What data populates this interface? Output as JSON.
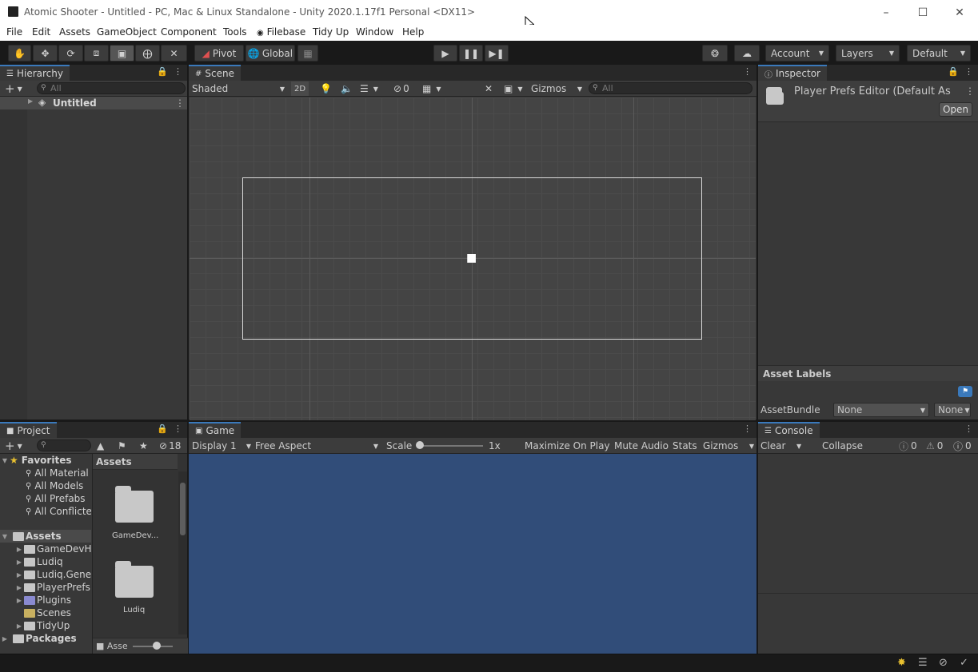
{
  "window": {
    "title": "Atomic Shooter - Untitled - PC, Mac & Linux Standalone - Unity 2020.1.17f1 Personal <DX11>"
  },
  "menu": [
    "File",
    "Edit",
    "Assets",
    "GameObject",
    "Component",
    "Tools",
    "Filebase",
    "Tidy Up",
    "Window",
    "Help"
  ],
  "toolbar": {
    "pivot": "Pivot",
    "global": "Global",
    "account": "Account",
    "layers": "Layers",
    "layout": "Default"
  },
  "hierarchy": {
    "tab": "Hierarchy",
    "search_placeholder": "All",
    "scene_name": "Untitled"
  },
  "scene": {
    "tab": "Scene",
    "shading": "Shaded",
    "mode_2d": "2D",
    "hidden_count": "0",
    "gizmos": "Gizmos",
    "search_placeholder": "All"
  },
  "inspector": {
    "tab": "Inspector",
    "title": "Player Prefs Editor (Default As",
    "open": "Open",
    "asset_labels": "Asset Labels",
    "assetbundle_label": "AssetBundle",
    "assetbundle_value": "None",
    "variant_value": "None"
  },
  "project": {
    "tab": "Project",
    "hidden_count": "18",
    "favorites_label": "Favorites",
    "favorites": [
      "All Material",
      "All Models",
      "All Prefabs",
      "All Conflicte"
    ],
    "assets_label": "Assets",
    "assets": [
      "GameDevH",
      "Ludiq",
      "Ludiq.Gene",
      "PlayerPrefs",
      "Plugins",
      "Scenes",
      "TidyUp"
    ],
    "packages_label": "Packages",
    "grid_header": "Assets",
    "grid_items": [
      "GameDev...",
      "Ludiq"
    ],
    "footer_path": "Asse"
  },
  "game": {
    "tab": "Game",
    "display": "Display 1",
    "aspect": "Free Aspect",
    "scale_label": "Scale",
    "scale_value": "1x",
    "maximize": "Maximize On Play",
    "mute": "Mute Audio",
    "stats": "Stats",
    "gizmos": "Gizmos"
  },
  "console": {
    "tab": "Console",
    "clear": "Clear",
    "collapse": "Collapse",
    "info_count": "0",
    "warn_count": "0",
    "error_count": "0"
  },
  "colors": {
    "game_background": "#314d79",
    "panel": "#383838",
    "tab_highlight": "#3a79bb"
  }
}
